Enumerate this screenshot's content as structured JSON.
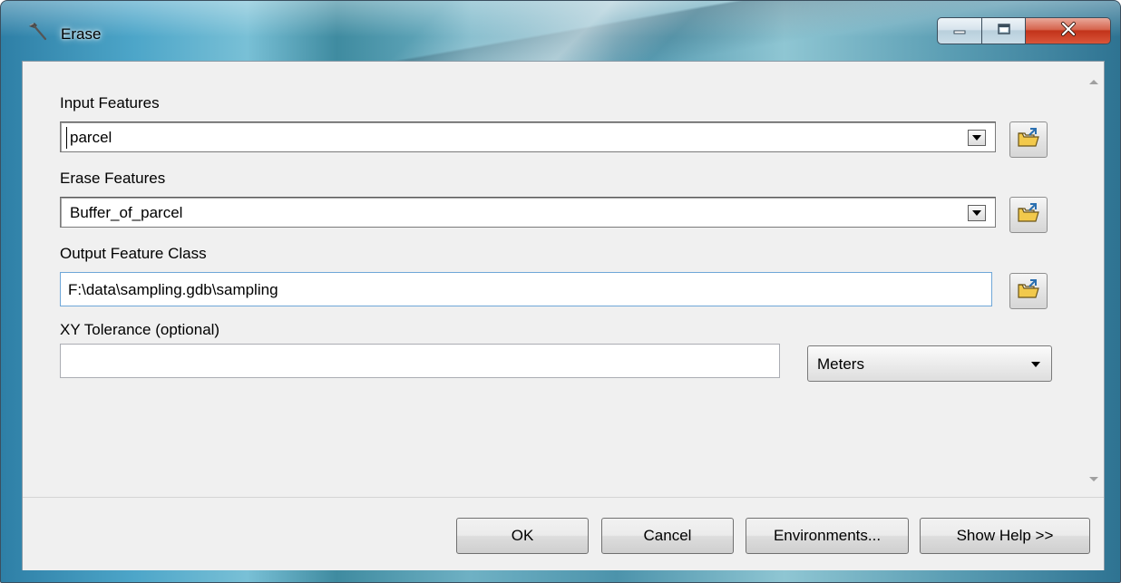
{
  "window": {
    "title": "Erase",
    "title_icon": "hammer-icon",
    "caption": {
      "minimize_icon": "minimize-icon",
      "maximize_icon": "maximize-icon",
      "close_icon": "close-icon"
    }
  },
  "form": {
    "input_features": {
      "label": "Input Features",
      "value": "parcel"
    },
    "erase_features": {
      "label": "Erase Features",
      "value": "Buffer_of_parcel"
    },
    "output_feature_class": {
      "label": "Output Feature Class",
      "value": "F:\\data\\sampling.gdb\\sampling"
    },
    "xy_tolerance": {
      "label": "XY Tolerance (optional)",
      "value": "",
      "unit": "Meters"
    },
    "browse_icon": "open-folder-icon"
  },
  "buttons": {
    "ok": "OK",
    "cancel": "Cancel",
    "environments": "Environments...",
    "show_help": "Show Help >>"
  },
  "colors": {
    "client_bg": "#f0f0f0",
    "close_button": "#c2331a",
    "focus_border": "#6fa7d8"
  }
}
